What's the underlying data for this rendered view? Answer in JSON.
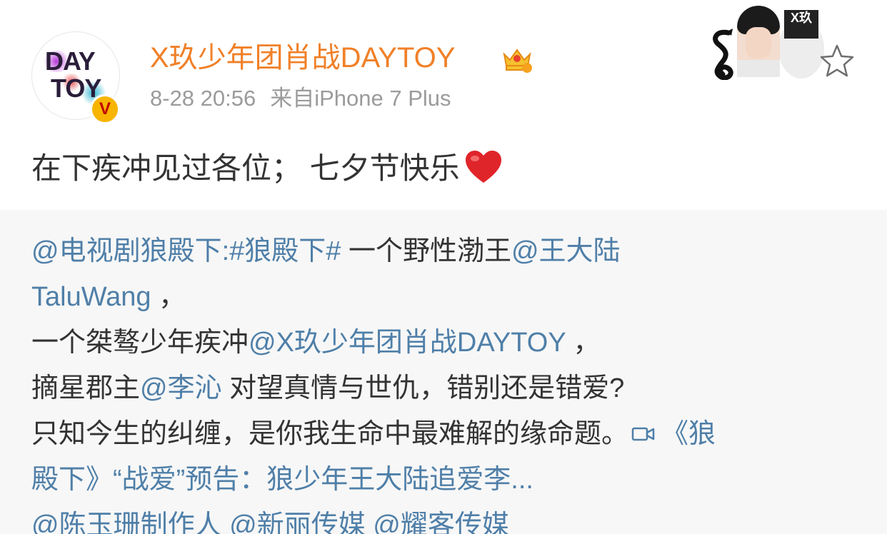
{
  "post": {
    "username": "X玖少年团肖战DAYTOY",
    "time": "8-28 20:56",
    "source": "来自iPhone 7 Plus",
    "text": "在下疾冲见过各位； 七夕节快乐",
    "avatar": {
      "text_line1": "DAY",
      "text_line2": "TOY"
    },
    "verified_label": "V",
    "card_logo": "X玖"
  },
  "repost": {
    "line1": [
      {
        "t": "@电视剧狼殿下",
        "link": true
      },
      {
        "t": ":",
        "link": true
      },
      {
        "t": "#狼殿下#",
        "link": true
      },
      {
        "t": " 一个野性渤王",
        "link": false
      },
      {
        "t": "@王大陆",
        "link": true
      }
    ],
    "line2": [
      {
        "t": "TaluWang",
        "link": true
      },
      {
        "t": " ，",
        "link": false
      }
    ],
    "line3": [
      {
        "t": "一个桀骜少年疾冲",
        "link": false
      },
      {
        "t": "@X玖少年团肖战DAYTOY",
        "link": true
      },
      {
        "t": " ，",
        "link": false
      }
    ],
    "line4": [
      {
        "t": "摘星郡主",
        "link": false
      },
      {
        "t": "@李沁",
        "link": true
      },
      {
        "t": " 对望真情与世仇，错别还是错爱?",
        "link": false
      }
    ],
    "line5": [
      {
        "t": "只知今生的纠缠，是你我生命中最难解的缘命题。",
        "link": false
      }
    ],
    "line5_link": "《狼",
    "line6": [
      {
        "t": "殿下》“战爱”预告：狼少年王大陆追爱李...",
        "link": true
      }
    ],
    "line7": [
      {
        "t": "@陈玉珊制作人",
        "link": true
      },
      {
        "t": " ",
        "link": false
      },
      {
        "t": "@新丽传媒",
        "link": true
      },
      {
        "t": " ",
        "link": false
      },
      {
        "t": "@耀客传媒",
        "link": true
      }
    ]
  },
  "colors": {
    "username": "#f08028",
    "link": "#4f7fa8",
    "meta": "#9b9b9b",
    "repost_bg": "#f7f7f7",
    "heart": "#e0252a"
  },
  "icons": [
    "vip-crown-icon",
    "verified-icon",
    "star-icon",
    "heart-icon",
    "video-icon"
  ]
}
